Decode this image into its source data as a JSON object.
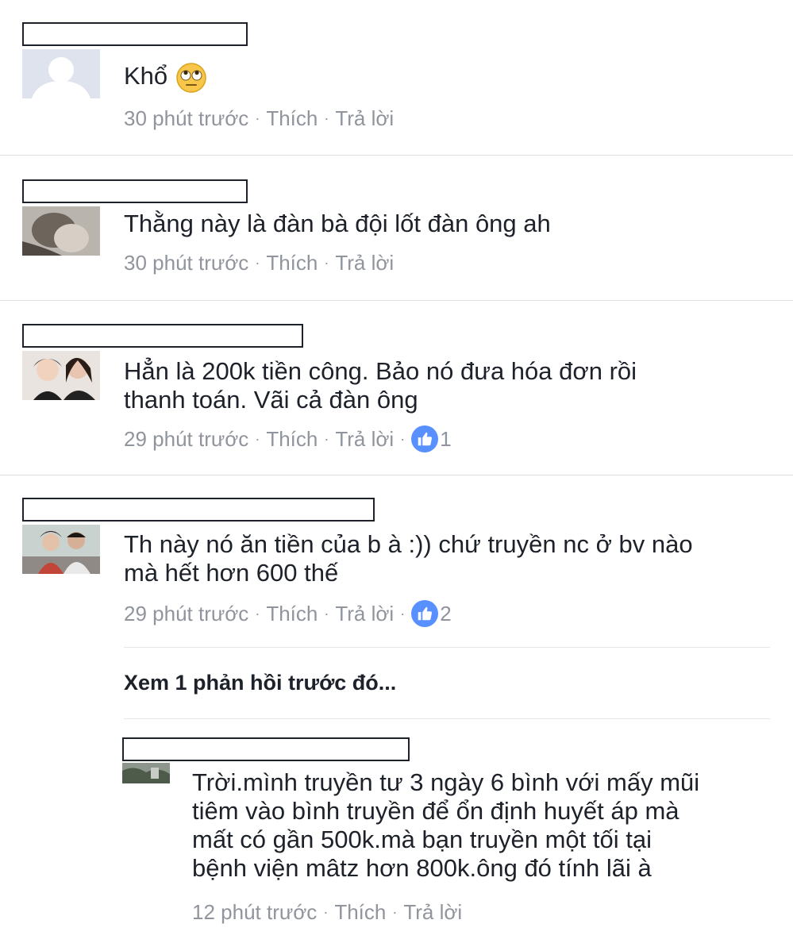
{
  "comments": [
    {
      "text_lines": [
        "Khổ"
      ],
      "time": "30 phút trước",
      "like_label": "Thích",
      "reply_label": "Trả lời",
      "emoji": "rolling-eyes-emoji"
    },
    {
      "text_lines": [
        "Thằng này là đàn bà đội lốt đàn ông ah"
      ],
      "time": "30 phút trước",
      "like_label": "Thích",
      "reply_label": "Trả lời"
    },
    {
      "text_lines": [
        "Hẳn là 200k tiền công. Bảo nó đưa hóa đơn rồi",
        "thanh toán. Vãi cả đàn ông"
      ],
      "time": "29 phút trước",
      "like_label": "Thích",
      "reply_label": "Trả lời",
      "like_count": "1"
    },
    {
      "text_lines": [
        "Th này nó ăn tiền của b à :)) chứ truyền nc ở bv nào",
        "mà hết hơn 600 thế"
      ],
      "time": "29 phút trước",
      "like_label": "Thích",
      "reply_label": "Trả lời",
      "like_count": "2"
    }
  ],
  "view_previous_replies": "Xem 1 phản hồi trước đó...",
  "reply": {
    "text_lines": [
      "Trời.mình truyền tư 3 ngày 6 bình với mấy mũi",
      "tiêm vào bình truyền để ổn định huyết áp mà",
      "mất có gần 500k.mà bạn truyền một tối tại",
      "bệnh viện mâtz hơn 800k.ông đó tính lãi à"
    ],
    "time": "12 phút trước",
    "like_label": "Thích",
    "reply_label": "Trả lời"
  },
  "separator": "·",
  "colors": {
    "text": "#1d2129",
    "meta": "#90949c",
    "like_badge": "#5890ff",
    "divider": "#dddfe2"
  }
}
